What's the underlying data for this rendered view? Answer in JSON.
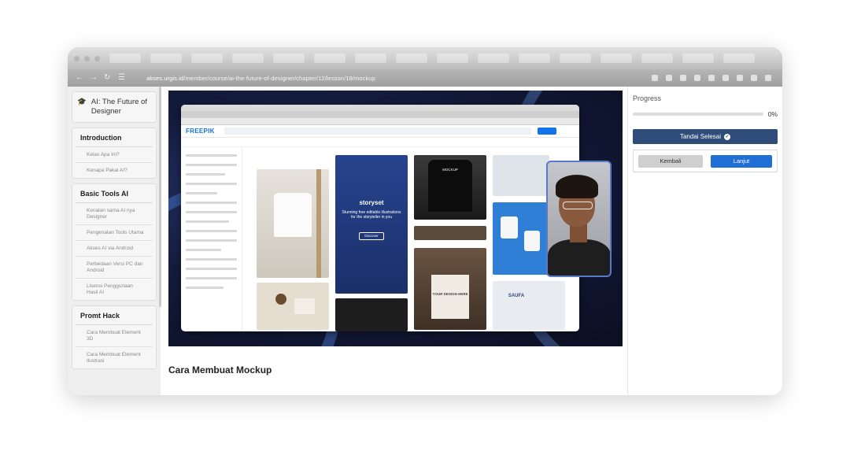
{
  "browser": {
    "url_host": "akses.urgis.id",
    "url_path": "/member/course/ai-the-future-of-designer/chapter/12/lesson/18/mockup",
    "icons": [
      "back-arrow-icon",
      "forward-arrow-icon",
      "reload-icon",
      "site-info-icon"
    ]
  },
  "sidebar": {
    "course_icon": "graduation-cap-icon",
    "course_title": "AI: The Future of Designer",
    "sections": [
      {
        "title": "Introduction",
        "lessons": [
          "Kelas Apa Ini?",
          "Kenapa Pakai AI?"
        ]
      },
      {
        "title": "Basic Tools AI",
        "lessons": [
          "Kenalan sama AI nya Designer",
          "Pengenalan Tools Utama",
          "Akses AI via Android",
          "Perbedaan Versi PC dan Android",
          "Lisensi Penggunaan Hasil AI"
        ]
      },
      {
        "title": "Promt Hack",
        "lessons": [
          "Cara Membuat Element 3D",
          "Cara Membuat Element Ilustrasi"
        ]
      }
    ]
  },
  "main": {
    "video": {
      "app_logo": "FREEPIK",
      "storyset_title": "storyset",
      "storyset_text": "Stunning free editable illustrations for the storyteller in you",
      "storyset_button": "Discover",
      "mockup_text": "MOCKUP",
      "bag_text": "YOUR DESIGN HERE",
      "sign_text": "SAUFA"
    },
    "lesson_title": "Cara Membuat Mockup"
  },
  "right_panel": {
    "progress_label": "Progress",
    "progress_value": 0,
    "progress_text": "0%",
    "complete_button": "Tandai Selesai",
    "complete_icon": "check-circle-icon",
    "back_button": "Kembali",
    "next_button": "Lanjut"
  },
  "colors": {
    "primary": "#2f4d78",
    "accent": "#1f6fd6",
    "freepik_blue": "#1273eb"
  }
}
